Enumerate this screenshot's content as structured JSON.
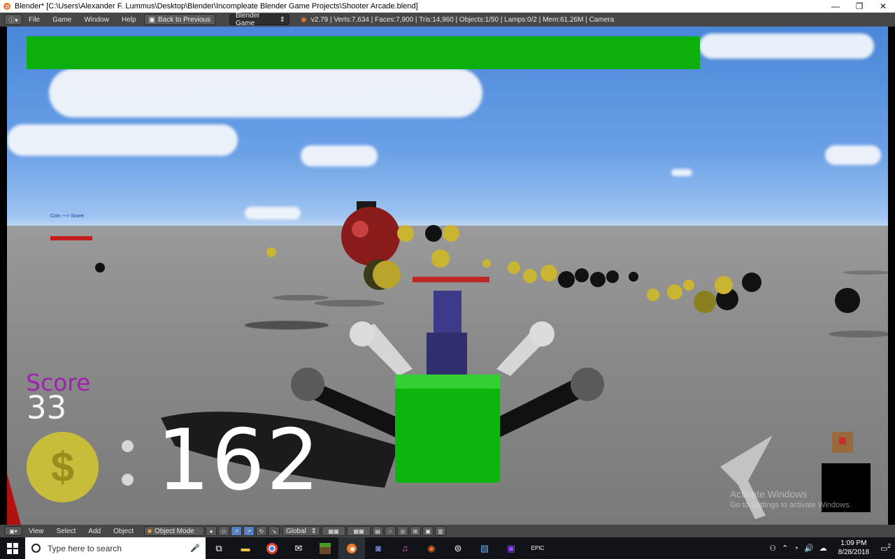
{
  "window": {
    "title": "Blender* [C:\\Users\\Alexander F. Lummus\\Desktop\\Blender\\Incompleate Blender Game Projects\\Shooter Arcade.blend]",
    "minimize": "—",
    "maximize": "❐",
    "close": "✕"
  },
  "header": {
    "editor_icon": "info-icon",
    "menus": [
      "File",
      "Game",
      "Window",
      "Help"
    ],
    "back_button": "Back to Previous",
    "engine": "Blender Game",
    "stats": "v2.79 | Verts:7,634 | Faces:7,900 | Tris:14,960 | Objects:1/50 | Lamps:0/2 | Mem:61.26M | Camera"
  },
  "game": {
    "coin_note": "Coin ---> Score",
    "score_label": "Score",
    "score_value": "33",
    "coin_symbol": "$",
    "coin_count": "162",
    "health_color": "#0caf0c"
  },
  "watermark": {
    "line1": "Activate Windows",
    "line2": "Go to Settings to activate Windows."
  },
  "footer": {
    "menus": [
      "View",
      "Select",
      "Add",
      "Object"
    ],
    "mode": "Object Mode",
    "orientation": "Global"
  },
  "taskbar": {
    "search_placeholder": "Type here to search",
    "time": "1:09 PM",
    "date": "8/28/2018",
    "notification_count": "2",
    "apps": [
      "task-view-icon",
      "file-explorer-icon",
      "chrome-icon",
      "mail-icon",
      "minecraft-icon",
      "blender-icon",
      "discord-icon",
      "itunes-icon",
      "origin-icon",
      "steam-icon",
      "photos-icon",
      "twitch-icon",
      "epic-games-icon"
    ]
  }
}
